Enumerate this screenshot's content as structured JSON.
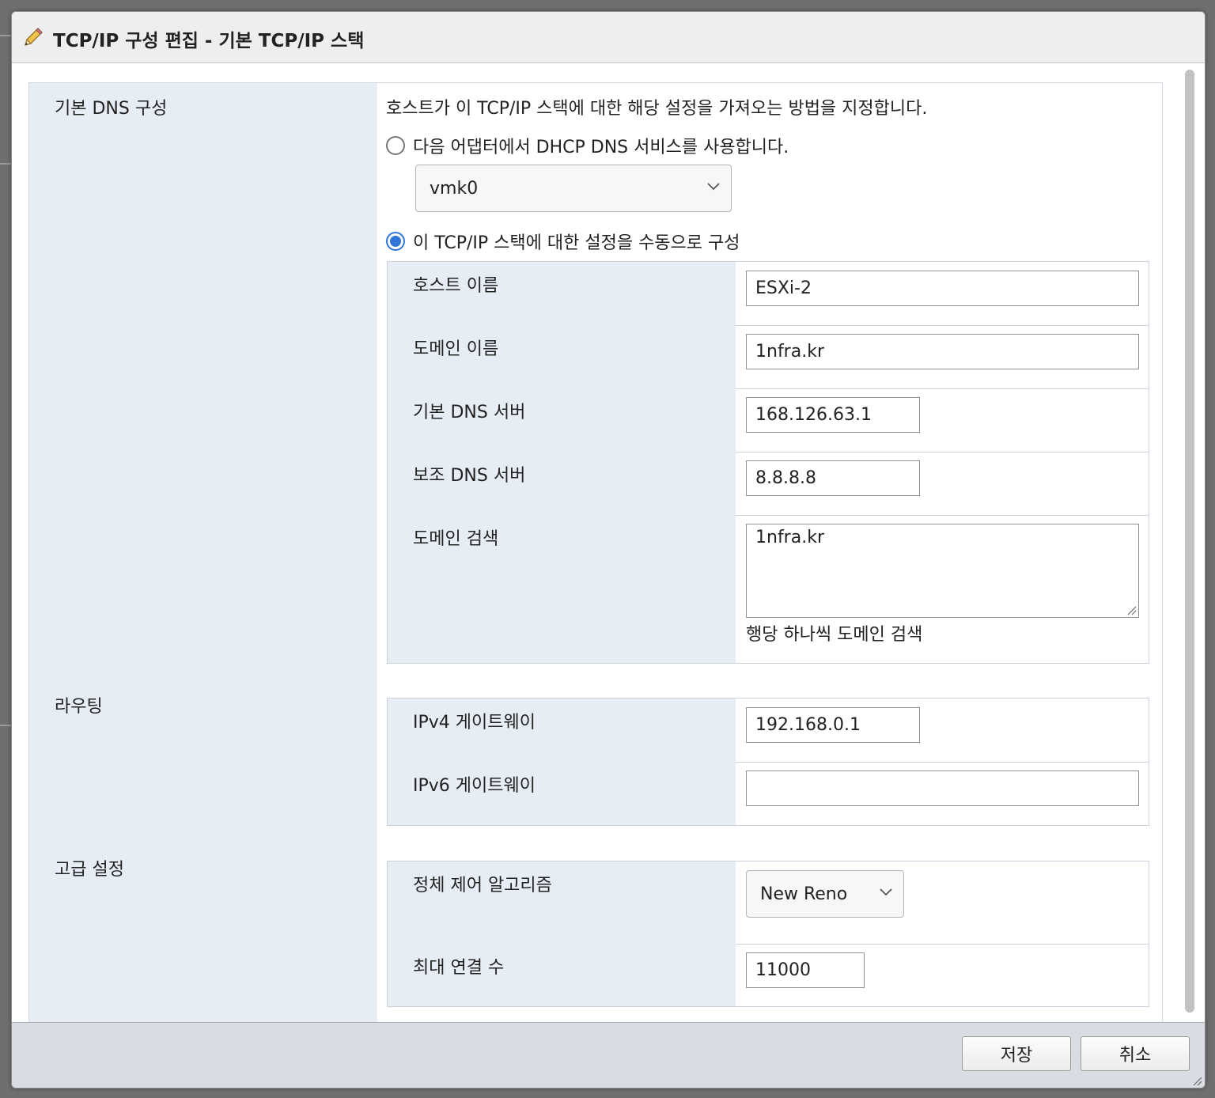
{
  "dialog": {
    "title": "TCP/IP 구성 편집 - 기본 TCP/IP 스택",
    "icon": "pencil-icon"
  },
  "dns": {
    "section_label": "기본 DNS 구성",
    "description": "호스트가 이 TCP/IP 스택에 대한 해당 설정을 가져오는 방법을 지정합니다.",
    "option_dhcp": {
      "label": "다음 어댑터에서 DHCP DNS 서비스를 사용합니다.",
      "selected": false
    },
    "adapter": {
      "value": "vmk0"
    },
    "option_manual": {
      "label": "이 TCP/IP 스택에 대한 설정을 수동으로 구성",
      "selected": true
    },
    "host_name": {
      "label": "호스트 이름",
      "value": "ESXi-2"
    },
    "domain_name": {
      "label": "도메인 이름",
      "value": "1nfra.kr"
    },
    "primary_dns": {
      "label": "기본 DNS 서버",
      "value": "168.126.63.1"
    },
    "secondary_dns": {
      "label": "보조 DNS 서버",
      "value": "8.8.8.8"
    },
    "search_domains": {
      "label": "도메인 검색",
      "value": "1nfra.kr",
      "hint": "행당 하나씩 도메인 검색"
    }
  },
  "routing": {
    "section_label": "라우팅",
    "ipv4_gateway": {
      "label": "IPv4 게이트웨이",
      "value": "192.168.0.1"
    },
    "ipv6_gateway": {
      "label": "IPv6 게이트웨이",
      "value": ""
    }
  },
  "advanced": {
    "section_label": "고급 설정",
    "congestion_control": {
      "label": "정체 제어 알고리즘",
      "value": "New Reno"
    },
    "max_connections": {
      "label": "최대 연결 수",
      "value": "11000"
    }
  },
  "footer": {
    "save_label": "저장",
    "cancel_label": "취소"
  },
  "colors": {
    "accent": "#2f76d6",
    "label_column": "#e6edf5",
    "footer": "#d9dde3"
  }
}
